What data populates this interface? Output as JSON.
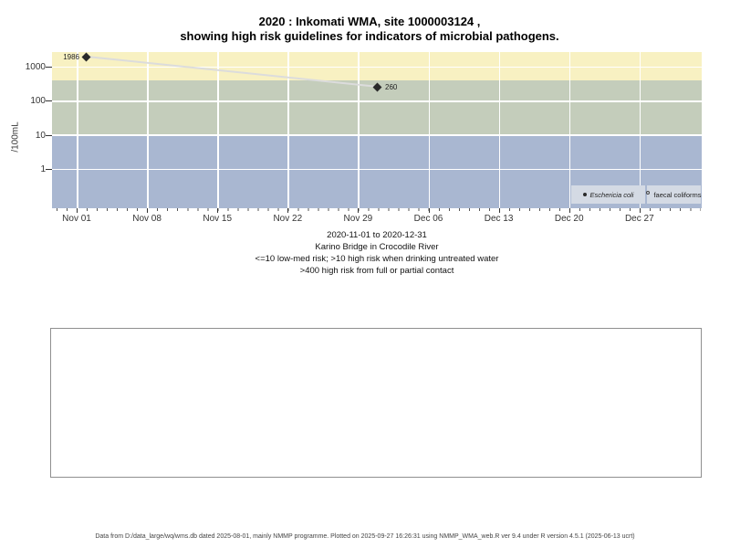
{
  "title": {
    "line1": "2020 : Inkomati WMA, site 1000003124 ,",
    "line2": "showing high risk guidelines for indicators of microbial pathogens."
  },
  "chart_data": {
    "type": "scatter",
    "y_scale": "log",
    "ylabel": "/100mL",
    "ylim": [
      0.07,
      2800
    ],
    "y_ticks": [
      "1000",
      "100",
      "10",
      "1"
    ],
    "x_ticks": [
      "Nov 01",
      "Nov 08",
      "Nov 15",
      "Nov 22",
      "Nov 29",
      "Dec 06",
      "Dec 13",
      "Dec 20",
      "Dec 27"
    ],
    "x_range": "2020-11-01 to 2020-12-31",
    "grid": true,
    "legend_position": "bottom-right",
    "series": [
      {
        "name": "Eschericia coli",
        "marker": "filled-diamond",
        "points": [
          {
            "x": "2020-11-02",
            "value": 1986,
            "label": "1986"
          },
          {
            "x": "2020-12-01",
            "value": 260,
            "label": "260"
          }
        ]
      },
      {
        "name": "faecal coliforms",
        "marker": "open-circle",
        "points": []
      }
    ],
    "risk_bands": [
      {
        "range": ">400",
        "meaning": "high risk from full or partial contact",
        "color": "#F8F1C2"
      },
      {
        "range": ">10 to 400",
        "meaning": "high risk when drinking untreated water",
        "color": "#C4CDBB"
      },
      {
        "range": "<=10",
        "meaning": "low-med risk",
        "color": "#A9B7D1"
      }
    ]
  },
  "subtitle": {
    "line1": "2020-11-01 to 2020-12-31",
    "line2": "Karino Bridge in Crocodile River",
    "line3": "<=10 low-med risk; >10 high risk when drinking untreated water",
    "line4": ">400 high risk from full or partial contact"
  },
  "footer": {
    "text": "Data from D:/data_large/wq/wms.db dated 2025-08-01, mainly NMMP programme. Plotted on 2025-09-27 16:26:31 using NMMP_WMA_web.R ver 9.4 under R version 4.5.1 (2025-06-13 ucrt)"
  },
  "colors": {
    "band_high_risk": "#F8F1C2",
    "band_mid_risk": "#C4CDBB",
    "band_low_risk": "#A9B7D1",
    "legend_background": "#D4DAE4",
    "gridline": "#FFFFFF",
    "marker": "#2A2A2A",
    "trend_line": "#DCDCDC"
  }
}
